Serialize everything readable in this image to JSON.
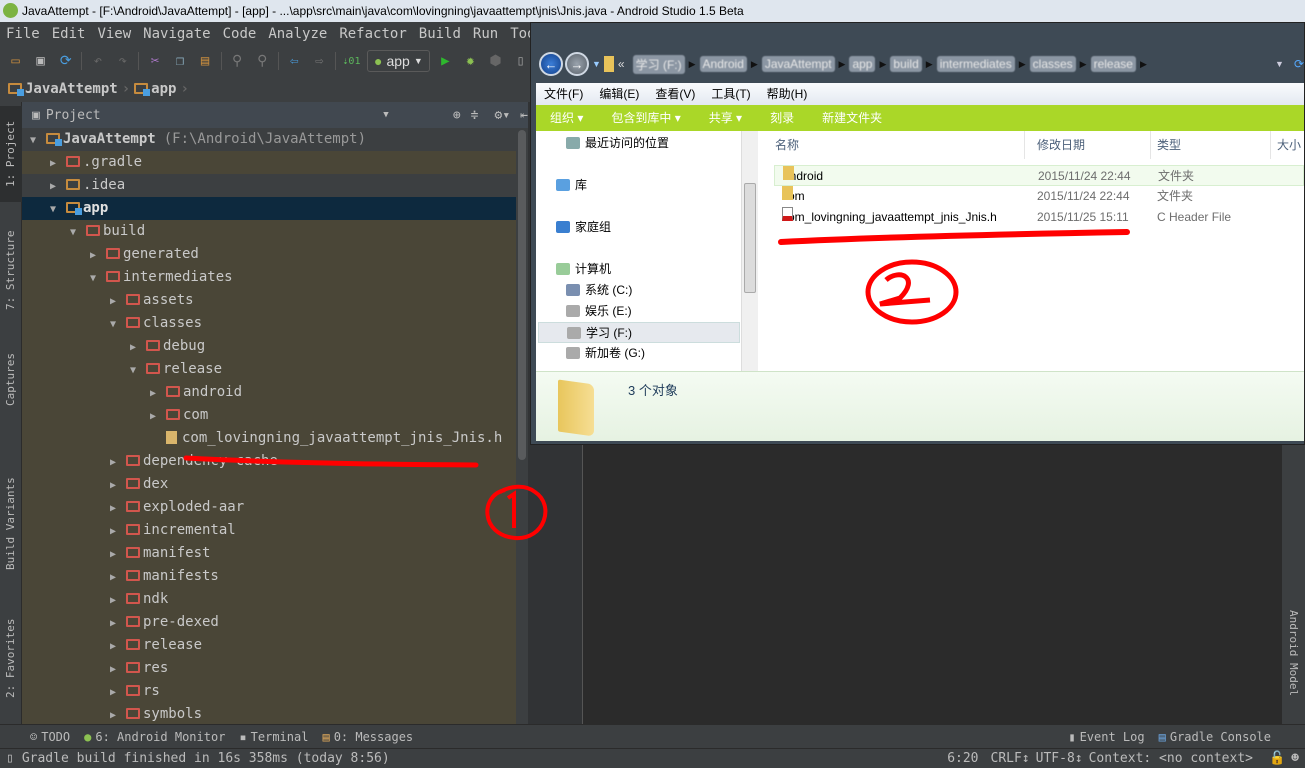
{
  "window": {
    "title": "JavaAttempt - [F:\\Android\\JavaAttempt] - [app] - ...\\app\\src\\main\\java\\com\\lovingning\\javaattempt\\jnis\\Jnis.java - Android Studio 1.5 Beta"
  },
  "menu": [
    "File",
    "Edit",
    "View",
    "Navigate",
    "Code",
    "Analyze",
    "Refactor",
    "Build",
    "Run",
    "Tools"
  ],
  "toolbar": {
    "run_config": "app"
  },
  "breadcrumb": [
    "JavaAttempt",
    "app"
  ],
  "left_tabs": [
    "1: Project",
    "7: Structure",
    "Captures",
    "Build Variants",
    "2: Favorites"
  ],
  "right_tabs": [
    "Android Model"
  ],
  "project_panel": {
    "view_label": "Project"
  },
  "tree": [
    {
      "label": "JavaAttempt",
      "extra": "(F:\\Android\\JavaAttempt)",
      "level": 0,
      "state": "expanded",
      "kind": "root"
    },
    {
      "label": ".gradle",
      "level": 1,
      "state": "collapsed",
      "kind": "excluded"
    },
    {
      "label": ".idea",
      "level": 1,
      "state": "collapsed",
      "kind": "plain"
    },
    {
      "label": "app",
      "level": 1,
      "state": "expanded",
      "kind": "module",
      "selected": true
    },
    {
      "label": "build",
      "level": 2,
      "state": "expanded",
      "kind": "excluded"
    },
    {
      "label": "generated",
      "level": 3,
      "state": "collapsed",
      "kind": "excluded"
    },
    {
      "label": "intermediates",
      "level": 3,
      "state": "expanded",
      "kind": "excluded"
    },
    {
      "label": "assets",
      "level": 4,
      "state": "collapsed",
      "kind": "excluded"
    },
    {
      "label": "classes",
      "level": 4,
      "state": "expanded",
      "kind": "excluded"
    },
    {
      "label": "debug",
      "level": 5,
      "state": "collapsed",
      "kind": "excluded"
    },
    {
      "label": "release",
      "level": 5,
      "state": "expanded",
      "kind": "excluded"
    },
    {
      "label": "android",
      "level": 6,
      "state": "collapsed",
      "kind": "excluded"
    },
    {
      "label": "com",
      "level": 6,
      "state": "collapsed",
      "kind": "excluded"
    },
    {
      "label": "com_lovingning_javaattempt_jnis_Jnis.h",
      "level": 6,
      "state": "leaf",
      "kind": "header"
    },
    {
      "label": "dependency-cache",
      "level": 4,
      "state": "collapsed",
      "kind": "excluded"
    },
    {
      "label": "dex",
      "level": 4,
      "state": "collapsed",
      "kind": "excluded"
    },
    {
      "label": "exploded-aar",
      "level": 4,
      "state": "collapsed",
      "kind": "excluded"
    },
    {
      "label": "incremental",
      "level": 4,
      "state": "collapsed",
      "kind": "excluded"
    },
    {
      "label": "manifest",
      "level": 4,
      "state": "collapsed",
      "kind": "excluded"
    },
    {
      "label": "manifests",
      "level": 4,
      "state": "collapsed",
      "kind": "excluded"
    },
    {
      "label": "ndk",
      "level": 4,
      "state": "collapsed",
      "kind": "excluded"
    },
    {
      "label": "pre-dexed",
      "level": 4,
      "state": "collapsed",
      "kind": "excluded"
    },
    {
      "label": "release",
      "level": 4,
      "state": "collapsed",
      "kind": "excluded"
    },
    {
      "label": "res",
      "level": 4,
      "state": "collapsed",
      "kind": "excluded"
    },
    {
      "label": "rs",
      "level": 4,
      "state": "collapsed",
      "kind": "excluded"
    },
    {
      "label": "symbols",
      "level": 4,
      "state": "collapsed",
      "kind": "excluded"
    }
  ],
  "bottom_tools": {
    "todo": "TODO",
    "android_monitor": "6: Android Monitor",
    "terminal": "Terminal",
    "messages": "0: Messages",
    "event_log": "Event Log",
    "gradle_console": "Gradle Console"
  },
  "status": {
    "message": "Gradle build finished in 16s 358ms (today 8:56)",
    "position": "6:20",
    "line_sep": "CRLF↕",
    "encoding": "UTF-8↕",
    "context": "Context: <no context>"
  },
  "explorer": {
    "path": [
      "学习 (F:)",
      "Android",
      "JavaAttempt",
      "app",
      "build",
      "intermediates",
      "classes",
      "release"
    ],
    "menu": [
      "文件(F)",
      "编辑(E)",
      "查看(V)",
      "工具(T)",
      "帮助(H)"
    ],
    "commands": [
      "组织 ▾",
      "包含到库中 ▾",
      "共享 ▾",
      "刻录",
      "新建文件夹"
    ],
    "nav": [
      {
        "label": "最近访问的位置",
        "icon": "recent-places-icon"
      },
      {
        "label": "库",
        "icon": "library-icon"
      },
      {
        "label": "家庭组",
        "icon": "homegroup-icon"
      },
      {
        "label": "计算机",
        "icon": "computer-icon"
      },
      {
        "label": "系统 (C:)",
        "icon": "system-drive-icon"
      },
      {
        "label": "娱乐 (E:)",
        "icon": "drive-icon"
      },
      {
        "label": "学习 (F:)",
        "icon": "drive-icon",
        "selected": true
      },
      {
        "label": "新加卷 (G:)",
        "icon": "drive-icon"
      }
    ],
    "columns": [
      "名称",
      "修改日期",
      "类型",
      "大小"
    ],
    "files": [
      {
        "name": "android",
        "date": "2015/11/24 22:44",
        "type": "文件夹",
        "icon": "folder-icon"
      },
      {
        "name": "com",
        "date": "2015/11/24 22:44",
        "type": "文件夹",
        "icon": "folder-icon"
      },
      {
        "name": "com_lovingning_javaattempt_jnis_Jnis.h",
        "date": "2015/11/25 15:11",
        "type": "C Header File",
        "icon": "c-header-file-icon"
      }
    ],
    "item_count": "3 个对象"
  },
  "annotations": {
    "color": "#ff0000",
    "marks": [
      "①",
      "②"
    ]
  }
}
